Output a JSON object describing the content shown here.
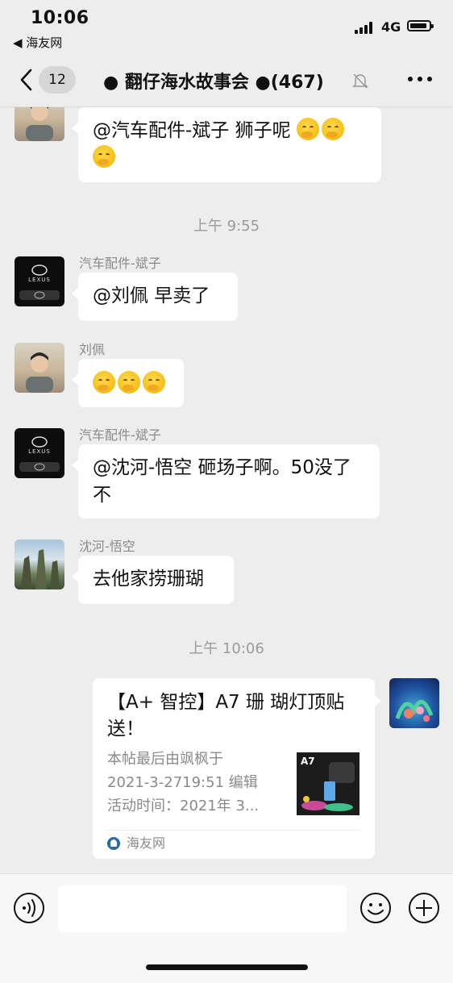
{
  "status_bar": {
    "time": "10:06",
    "back_app": "◀ 海友网",
    "network": "4G"
  },
  "nav": {
    "unread_count": "12",
    "title": "● 翻仔海水故事会 ●(467)",
    "icons": [
      "chevron-left-icon",
      "bell-mute-icon",
      "more-icon"
    ]
  },
  "messages": [
    {
      "text": "@汽车配件-斌子 狮子呢",
      "emoji_count": 3
    },
    {
      "timestamp": "上午 9:55"
    },
    {
      "sender": "汽车配件-斌子",
      "text": "@刘佩 早卖了"
    },
    {
      "sender": "刘佩",
      "emoji_count": 3
    },
    {
      "sender": "汽车配件-斌子",
      "text": "@沈河-悟空 砸场子啊。50没了不"
    },
    {
      "sender": "沈河-悟空",
      "text": "去他家捞珊瑚"
    },
    {
      "timestamp": "上午 10:06"
    }
  ],
  "link_card": {
    "title": "【A+ 智控】A7 珊 瑚灯顶贴送！",
    "desc_line1": "本帖最后由飒枫于",
    "desc_line2": "2021-3-2719:51 编辑",
    "desc_line3": "活动时间：2021年 3...",
    "thumb_label": "A7",
    "source": "海友网"
  },
  "colors": {
    "background": "#ededed",
    "bubble": "#ffffff",
    "meta_text": "#8a8a8a"
  }
}
